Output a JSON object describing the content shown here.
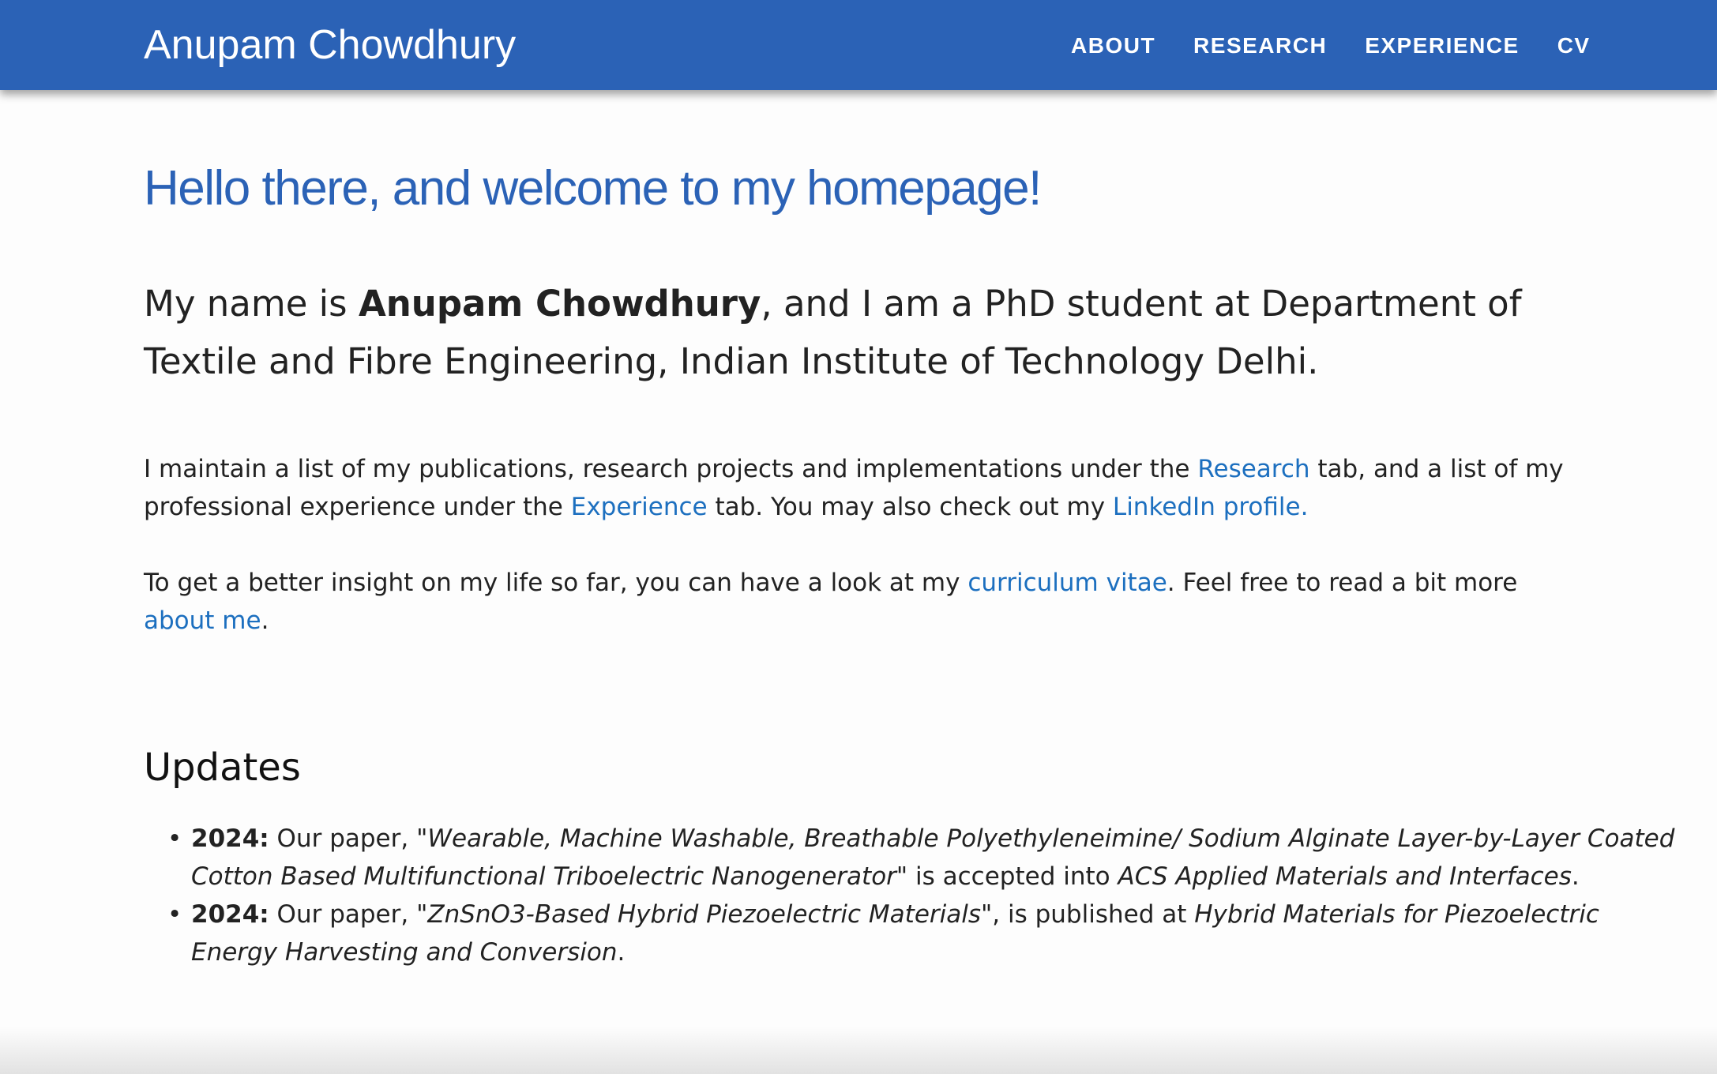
{
  "navbar": {
    "brand": "Anupam Chowdhury",
    "links": [
      "ABOUT",
      "RESEARCH",
      "EXPERIENCE",
      "CV"
    ],
    "background_color": "#2b62b6"
  },
  "main": {
    "welcome_heading": "Hello there, and welcome to my homepage!",
    "intro": {
      "prefix": "My name is ",
      "name": "Anupam Chowdhury",
      "suffix": ", and I am a PhD student at Department of Textile and Fibre Engineering, Indian Institute of Technology Delhi."
    },
    "para1": {
      "t1": "I maintain a list of my publications, research projects and implementations under the ",
      "link_research": "Research",
      "t2": " tab, and a list of my professional experience under the ",
      "link_experience": "Experience",
      "t3": " tab. You may also check out my ",
      "link_linkedin": "LinkedIn profile."
    },
    "para2": {
      "t1": "To get a better insight on my life so far, you can have a look at my ",
      "link_cv": "curriculum vitae",
      "t2": ". Feel free to read a bit more ",
      "link_about": "about me",
      "t3": "."
    },
    "link_color": "#1c6fbf",
    "heading_color": "#2b62b6"
  },
  "updates": {
    "title": "Updates",
    "items": [
      {
        "year": "2024:",
        "t1": " Our paper, ",
        "title": "\"Wearable, Machine Washable, Breathable Polyethyleneimine/ Sodium Alginate Layer-by-Layer Coated Cotton Based Multifunctional Triboelectric Nanogenerator\"",
        "t2": " is accepted into ",
        "venue": "ACS Applied Materials and Interfaces",
        "t3": "."
      },
      {
        "year": "2024:",
        "t1": " Our paper, ",
        "title": "\"ZnSnO3-Based Hybrid Piezoelectric Materials\"",
        "t2": ", is published at ",
        "venue": "Hybrid Materials for Piezoelectric Energy Harvesting and Conversion",
        "t3": "."
      }
    ]
  }
}
